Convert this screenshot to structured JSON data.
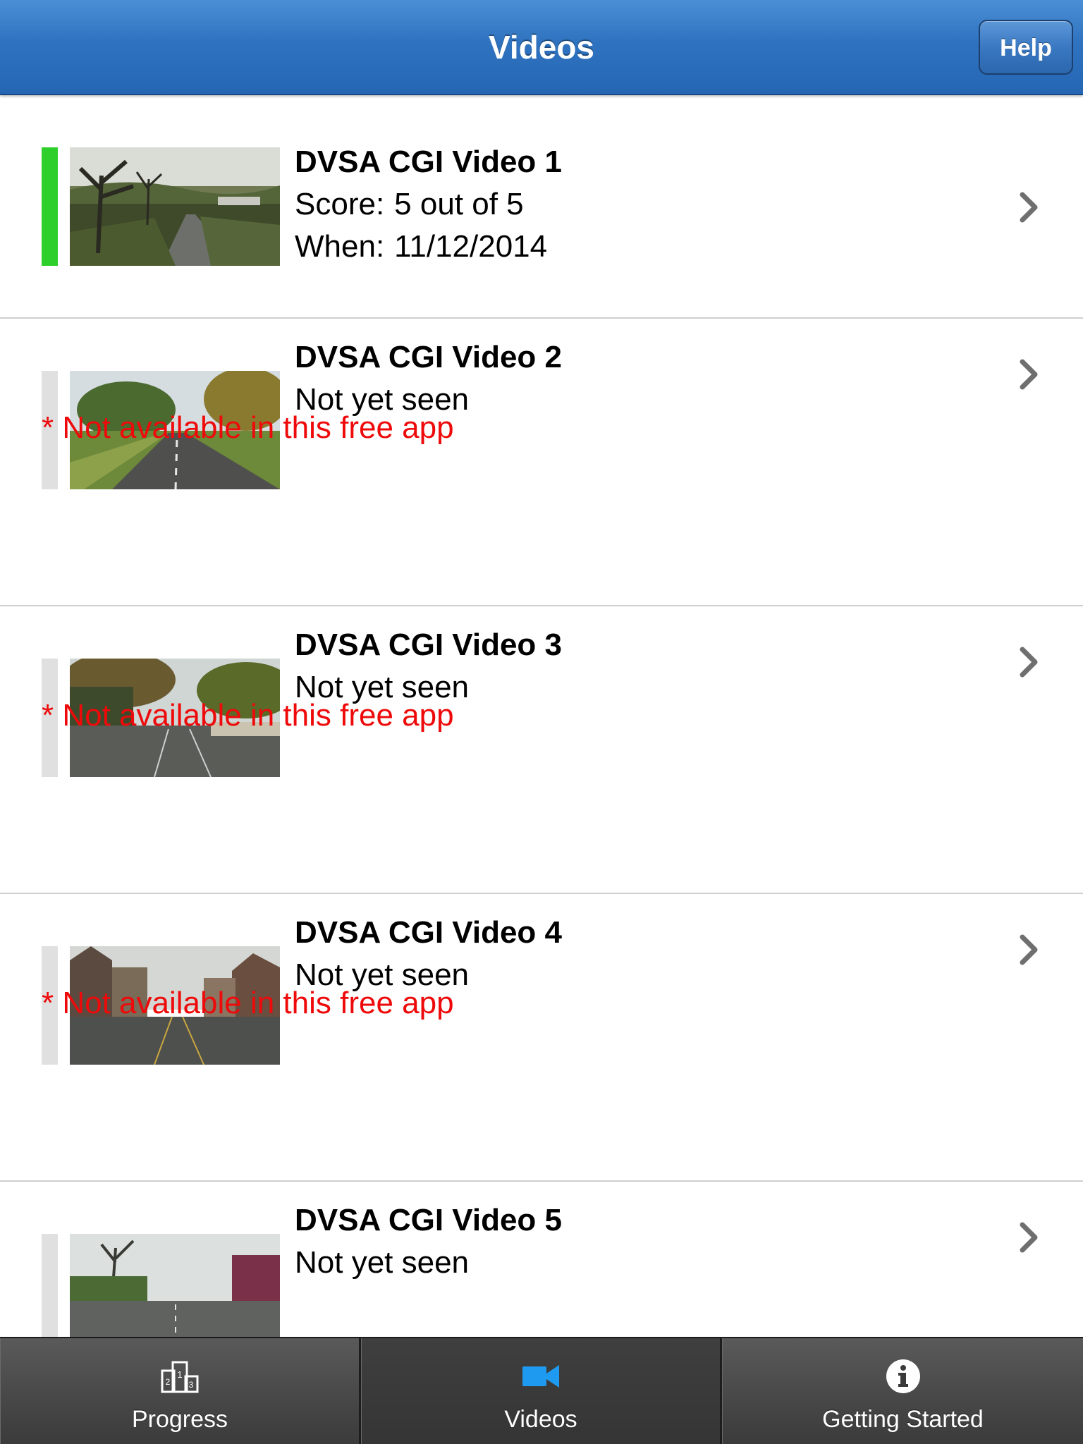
{
  "header": {
    "title": "Videos",
    "help_label": "Help"
  },
  "videos": [
    {
      "title": "DVSA CGI Video 1",
      "score_label": "Score:",
      "score_value": "5 out of 5",
      "when_label": "When:",
      "when_value": "11/12/2014",
      "status": "completed"
    },
    {
      "title": "DVSA CGI Video 2",
      "status_text": "Not yet seen",
      "notice": "* Not available in this free app",
      "status": "locked"
    },
    {
      "title": "DVSA CGI Video 3",
      "status_text": "Not yet seen",
      "notice": "* Not available in this free app",
      "status": "locked"
    },
    {
      "title": "DVSA CGI Video 4",
      "status_text": "Not yet seen",
      "notice": "* Not available in this free app",
      "status": "locked"
    },
    {
      "title": "DVSA CGI Video 5",
      "status_text": "Not yet seen",
      "status": "locked"
    }
  ],
  "tabbar": {
    "items": [
      {
        "label": "Progress",
        "icon": "podium-icon",
        "active": false
      },
      {
        "label": "Videos",
        "icon": "video-camera-icon",
        "active": true
      },
      {
        "label": "Getting Started",
        "icon": "info-icon",
        "active": false
      }
    ]
  },
  "colors": {
    "header_blue": "#2f73c0",
    "completed_green": "#2fcf2b",
    "pending_gray": "#e0e0e0",
    "notice_red": "#ee0a0a",
    "active_tab_icon": "#1e9bf0"
  }
}
